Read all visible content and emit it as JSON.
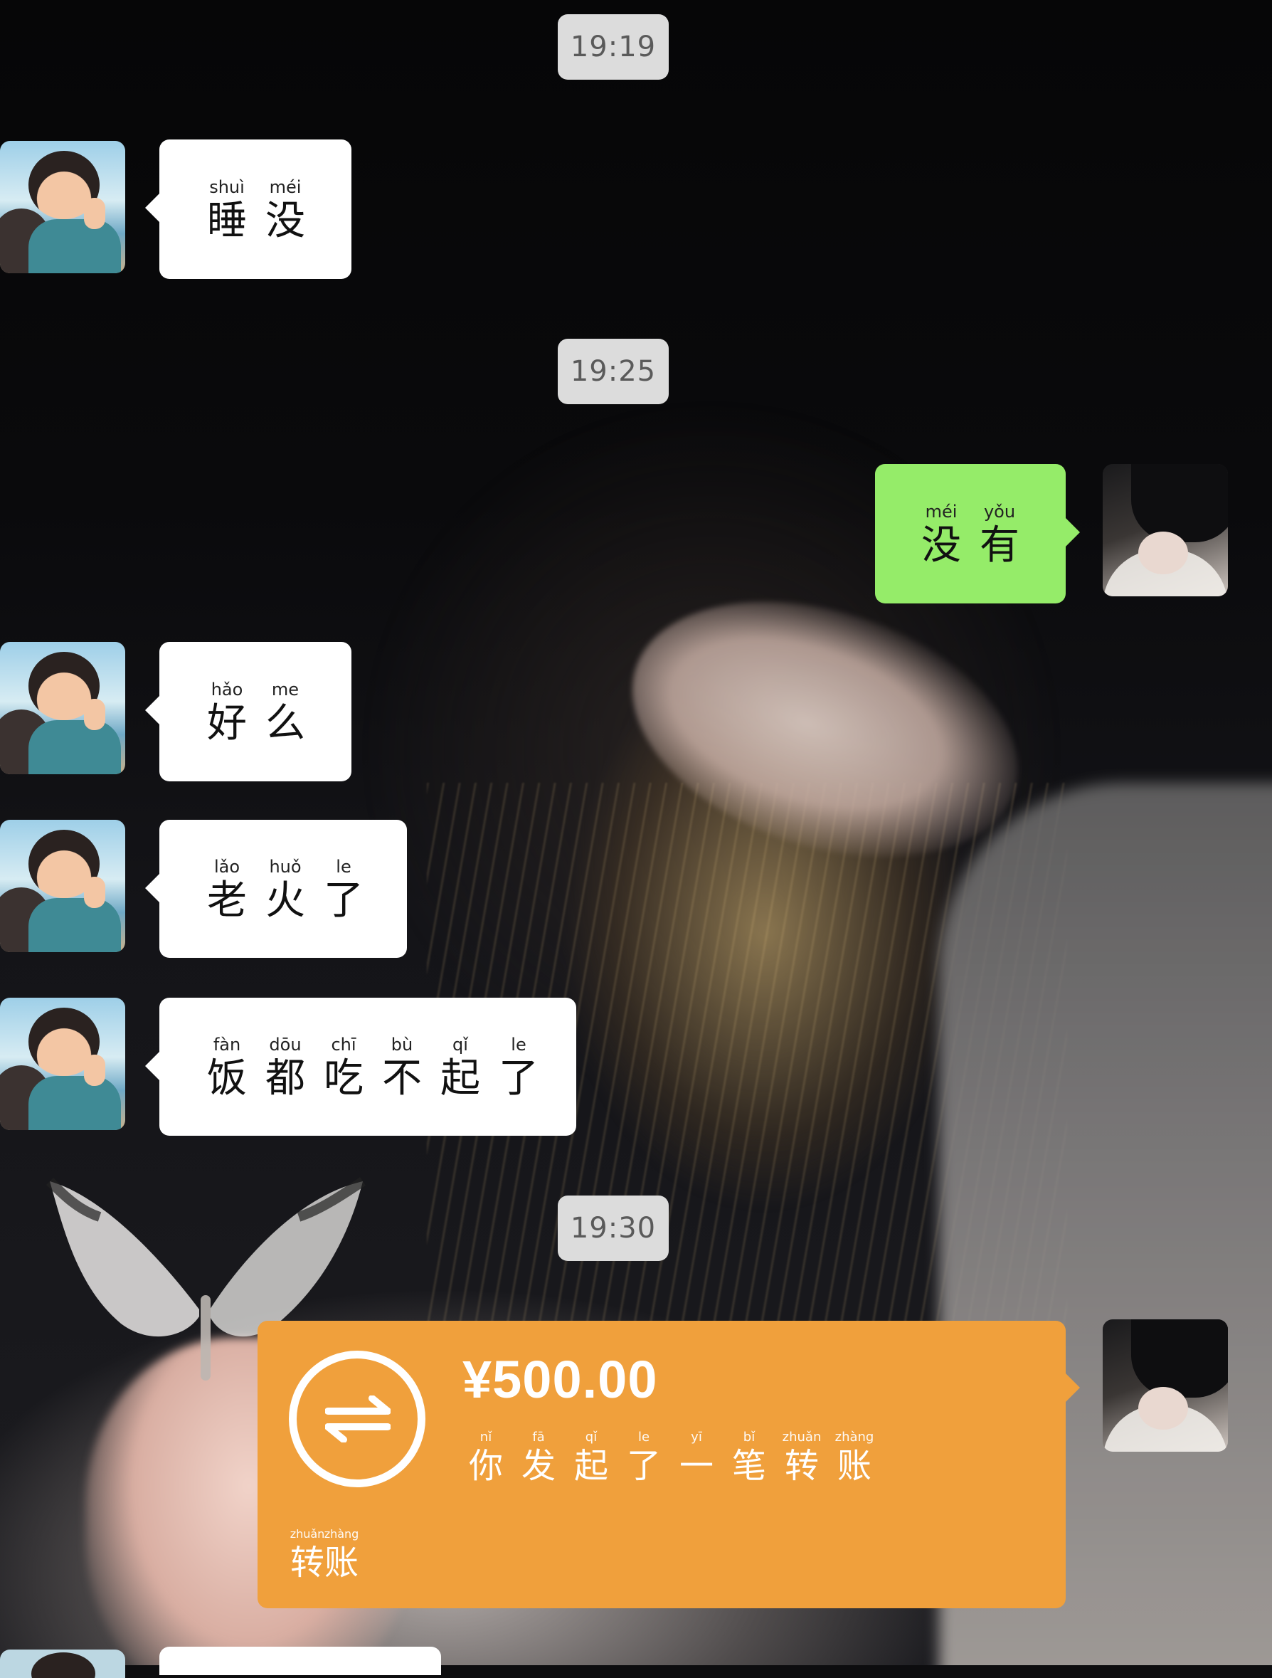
{
  "timestamps": [
    "19:19",
    "19:25",
    "19:30"
  ],
  "messages": [
    {
      "side": "left",
      "chars": [
        {
          "py": "shuì",
          "hz": "睡"
        },
        {
          "py": "méi",
          "hz": "没"
        }
      ]
    },
    {
      "side": "right",
      "chars": [
        {
          "py": "méi",
          "hz": "没"
        },
        {
          "py": "yǒu",
          "hz": "有"
        }
      ]
    },
    {
      "side": "left",
      "chars": [
        {
          "py": "hǎo",
          "hz": "好"
        },
        {
          "py": "me",
          "hz": "么"
        }
      ]
    },
    {
      "side": "left",
      "chars": [
        {
          "py": "lǎo",
          "hz": "老"
        },
        {
          "py": "huǒ",
          "hz": "火"
        },
        {
          "py": "le",
          "hz": "了"
        }
      ]
    },
    {
      "side": "left",
      "chars": [
        {
          "py": "fàn",
          "hz": "饭"
        },
        {
          "py": "dōu",
          "hz": "都"
        },
        {
          "py": "chī",
          "hz": "吃"
        },
        {
          "py": "bù",
          "hz": "不"
        },
        {
          "py": "qǐ",
          "hz": "起"
        },
        {
          "py": "le",
          "hz": "了"
        }
      ]
    }
  ],
  "transfer": {
    "amount": "¥500.00",
    "desc": [
      {
        "py": "nǐ",
        "hz": "你"
      },
      {
        "py": "fā",
        "hz": "发"
      },
      {
        "py": "qǐ",
        "hz": "起"
      },
      {
        "py": "le",
        "hz": "了"
      },
      {
        "py": "yī",
        "hz": "一"
      },
      {
        "py": "bǐ",
        "hz": "笔"
      },
      {
        "py": "zhuǎn",
        "hz": "转"
      },
      {
        "py": "zhàng",
        "hz": "账"
      }
    ],
    "label": [
      {
        "py": "zhuǎn",
        "hz": "转"
      },
      {
        "py": "zhàng",
        "hz": "账"
      }
    ],
    "color": "#f0a03c"
  },
  "colors": {
    "sent_bubble": "#95ec69",
    "received_bubble": "#ffffff",
    "timestamp_bg": "#dcdcdc"
  },
  "icons": {
    "transfer": "transfer-arrows-icon"
  }
}
